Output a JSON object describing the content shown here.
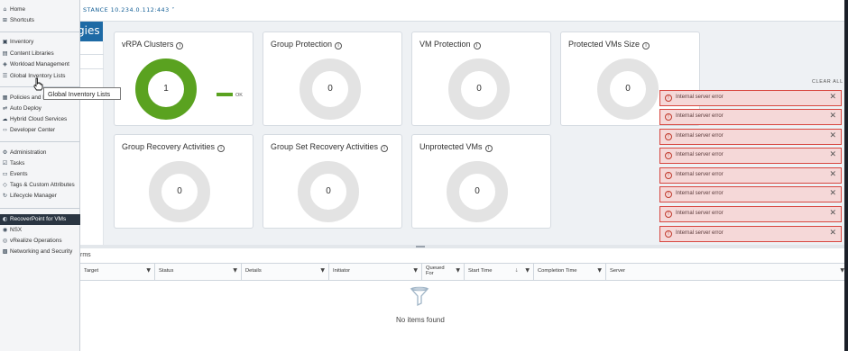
{
  "header": {
    "instance_label": "STANCE 10.234.0.112:443 ˅"
  },
  "brand": {
    "text": "gies"
  },
  "cards": [
    {
      "title": "vRPA Clusters",
      "value": "1",
      "style": "green",
      "legend": "OK"
    },
    {
      "title": "Group Protection",
      "value": "0"
    },
    {
      "title": "VM Protection",
      "value": "0"
    },
    {
      "title": "Protected VMs Size",
      "value": "0"
    },
    {
      "title": "Group Recovery Activities",
      "value": "0"
    },
    {
      "title": "Group Set Recovery Activities",
      "value": "0"
    },
    {
      "title": "Unprotected VMs",
      "value": "0"
    }
  ],
  "info_glyph": "i",
  "colors": {
    "ok_green": "#5aa220",
    "error_red": "#d7463f",
    "error_bg": "#f5d8d8",
    "menu_active": "#2a3542",
    "brand_blue": "#1d6aa5"
  },
  "notifications": {
    "clear_all": "CLEAR ALL",
    "items": [
      {
        "message": "Internal server error"
      },
      {
        "message": "Internal server error"
      },
      {
        "message": "Internal server error"
      },
      {
        "message": "Internal server error"
      },
      {
        "message": "Internal server error"
      },
      {
        "message": "Internal server error"
      },
      {
        "message": "Internal server error"
      },
      {
        "message": "Internal server error"
      }
    ],
    "error_glyph": "!",
    "close_glyph": "✕"
  },
  "bottom_panel": {
    "tab_label": "rms",
    "columns": [
      {
        "label": "Target"
      },
      {
        "label": "Status"
      },
      {
        "label": "Details"
      },
      {
        "label": "Initiator"
      },
      {
        "label": "Queued For"
      },
      {
        "label": "Start Time"
      },
      {
        "label": "Completion Time"
      },
      {
        "label": "Server"
      }
    ],
    "filter_glyph": "▼",
    "sort_glyph": "↓",
    "empty_text": "No items found"
  },
  "menu": {
    "items": [
      {
        "label": "Home",
        "icon": "home-icon",
        "glyph": "⌂"
      },
      {
        "label": "Shortcuts",
        "icon": "shortcuts-icon",
        "glyph": "⊞"
      },
      {
        "label": "Inventory",
        "icon": "inventory-icon",
        "glyph": "▣"
      },
      {
        "label": "Content Libraries",
        "icon": "library-icon",
        "glyph": "▤"
      },
      {
        "label": "Workload Management",
        "icon": "workload-icon",
        "glyph": "◈"
      },
      {
        "label": "Global Inventory Lists",
        "icon": "lists-icon",
        "glyph": "☰"
      },
      {
        "label": "Policies and Profiles",
        "icon": "policies-icon",
        "glyph": "▦"
      },
      {
        "label": "Auto Deploy",
        "icon": "deploy-icon",
        "glyph": "⇄"
      },
      {
        "label": "Hybrid Cloud Services",
        "icon": "cloud-icon",
        "glyph": "☁"
      },
      {
        "label": "Developer Center",
        "icon": "code-icon",
        "glyph": "‹›"
      },
      {
        "label": "Administration",
        "icon": "admin-icon",
        "glyph": "⚙"
      },
      {
        "label": "Tasks",
        "icon": "tasks-icon",
        "glyph": "☑"
      },
      {
        "label": "Events",
        "icon": "events-icon",
        "glyph": "▭"
      },
      {
        "label": "Tags & Custom Attributes",
        "icon": "tag-icon",
        "glyph": "◇"
      },
      {
        "label": "Lifecycle Manager",
        "icon": "lifecycle-icon",
        "glyph": "↻"
      },
      {
        "label": "RecoverPoint for VMs",
        "icon": "recoverpoint-icon",
        "glyph": "◐"
      },
      {
        "label": "NSX",
        "icon": "nsx-icon",
        "glyph": "◉"
      },
      {
        "label": "vRealize Operations",
        "icon": "vrops-icon",
        "glyph": "◎"
      },
      {
        "label": "Networking and Security",
        "icon": "network-icon",
        "glyph": "▩"
      }
    ]
  },
  "tooltip": {
    "text": "Global Inventory Lists"
  }
}
